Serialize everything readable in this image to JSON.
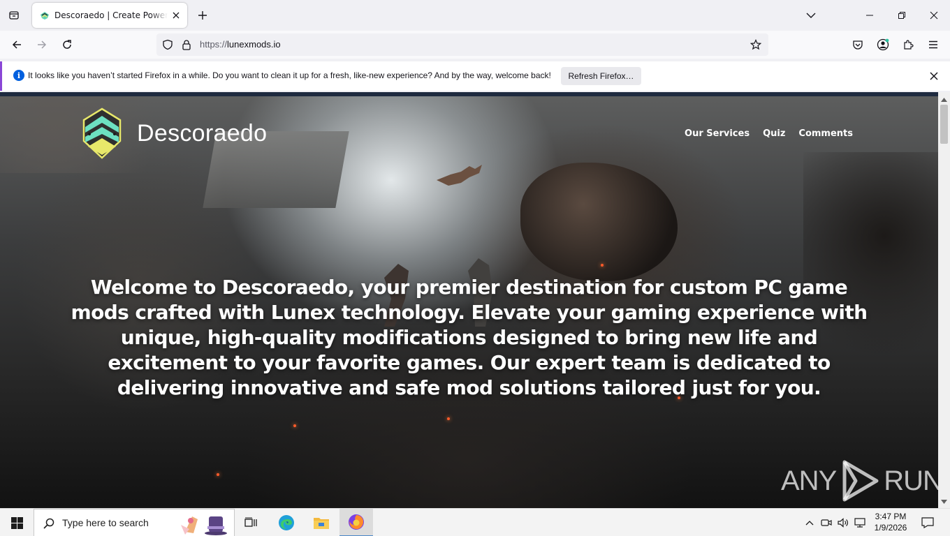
{
  "browser": {
    "tab": {
      "title": "Descoraedo | Create Powerful P",
      "favicon": "descoraedo-favicon"
    },
    "url_protocol": "https://",
    "url_host": "lunexmods.io",
    "window_controls": [
      "list-all-tabs-icon",
      "minimize-icon",
      "maximize-icon",
      "close-icon"
    ]
  },
  "notification": {
    "message": "It looks like you haven’t started Firefox in a while. Do you want to clean it up for a fresh, like-new experience? And by the way, welcome back!",
    "button_label": "Refresh Firefox…",
    "accent_color": "#8a46d6"
  },
  "site": {
    "brand_name": "Descoraedo",
    "nav": [
      {
        "label": "Our Services"
      },
      {
        "label": "Quiz"
      },
      {
        "label": "Comments"
      }
    ],
    "hero_text": "Welcome to Descoraedo, your premier destination for custom PC game mods crafted with Lunex technology. Elevate your gaming experience with unique, high-quality modifications designed to bring new life and excitement to your favorite games. Our expert team is dedicated to delivering innovative and safe mod solutions tailored just for you."
  },
  "watermark": {
    "left": "ANY",
    "right": "RUN"
  },
  "taskbar": {
    "search_placeholder": "Type here to search",
    "time": "3:47 PM",
    "date": "1/9/2026",
    "apps": [
      "task-view-icon",
      "edge-icon",
      "file-explorer-icon",
      "firefox-icon"
    ]
  }
}
